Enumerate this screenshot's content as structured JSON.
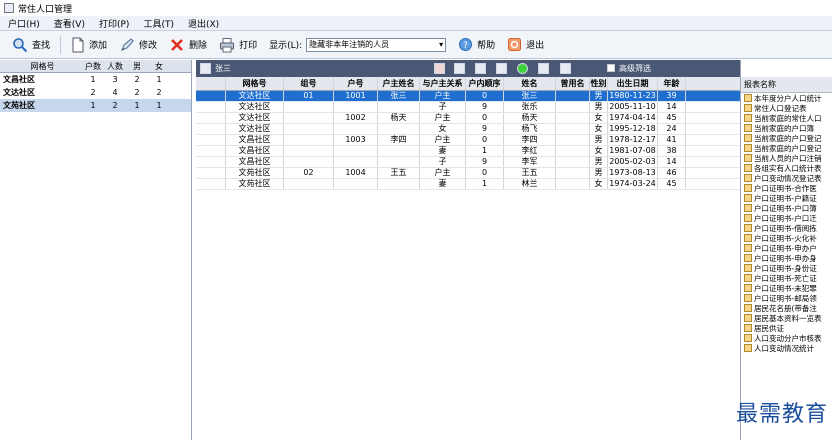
{
  "window": {
    "title": "常住人口管理"
  },
  "menu": [
    "户口(H)",
    "查看(V)",
    "打印(P)",
    "工具(T)",
    "退出(X)"
  ],
  "toolbar": {
    "search": "查找",
    "add": "添加",
    "edit": "修改",
    "delete": "删除",
    "print": "打印",
    "display_label": "显示(L):",
    "display_value": "隐藏非本年注销的人员",
    "help": "帮助",
    "exit": "退出"
  },
  "left_table": {
    "headers": [
      "网格号",
      "户数",
      "人数",
      "男",
      "女"
    ],
    "rows": [
      [
        "文昌社区",
        "1",
        "3",
        "2",
        "1"
      ],
      [
        "文达社区",
        "2",
        "4",
        "2",
        "2"
      ],
      [
        "文苑社区",
        "1",
        "2",
        "1",
        "1"
      ]
    ],
    "selected": 2
  },
  "main_toolbar": {
    "user": "张三",
    "filter_label": "高级筛选"
  },
  "main_table": {
    "headers": [
      "",
      "网格号",
      "组号",
      "户号",
      "户主姓名",
      "与户主关系",
      "户内顺序",
      "姓名",
      "曾用名",
      "性别",
      "出生日期",
      "年龄"
    ],
    "rows": [
      [
        "",
        "文达社区",
        "01",
        "1001",
        "张三",
        "户主",
        "0",
        "张三",
        "",
        "男",
        "1980-11-23",
        "39"
      ],
      [
        "",
        "文达社区",
        "",
        "",
        "",
        "子",
        "9",
        "张乐",
        "",
        "男",
        "2005-11-10",
        "14"
      ],
      [
        "",
        "文达社区",
        "",
        "1002",
        "杨天",
        "户主",
        "0",
        "杨天",
        "",
        "女",
        "1974-04-14",
        "45"
      ],
      [
        "",
        "文达社区",
        "",
        "",
        "",
        "女",
        "9",
        "杨飞",
        "",
        "女",
        "1995-12-18",
        "24"
      ],
      [
        "",
        "文昌社区",
        "",
        "1003",
        "李四",
        "户主",
        "0",
        "李四",
        "",
        "男",
        "1978-12-17",
        "41"
      ],
      [
        "",
        "文昌社区",
        "",
        "",
        "",
        "妻",
        "1",
        "李红",
        "",
        "女",
        "1981-07-08",
        "38"
      ],
      [
        "",
        "文昌社区",
        "",
        "",
        "",
        "子",
        "9",
        "李军",
        "",
        "男",
        "2005-02-03",
        "14"
      ],
      [
        "",
        "文苑社区",
        "02",
        "1004",
        "王五",
        "户主",
        "0",
        "王五",
        "",
        "男",
        "1973-08-13",
        "46"
      ],
      [
        "",
        "文苑社区",
        "",
        "",
        "",
        "妻",
        "1",
        "林兰",
        "",
        "女",
        "1974-03-24",
        "45"
      ]
    ],
    "selected": 0
  },
  "report_panel": {
    "header": "报表名称",
    "items": [
      "本年度分户人口统计",
      "常住人口登记表",
      "当前家庭的常住人口",
      "当前家庭的户口簿",
      "当前家庭的户口登记",
      "当前家庭的户口登记",
      "当前人员的户口注销",
      "各组实有人口统计表",
      "户口变动情况登记表",
      "户口证明书-合作医",
      "户口证明书-户籍证",
      "户口证明书-户口簿",
      "户口证明书-户口迁",
      "户口证明书-借阅拣",
      "户口证明书-火化补",
      "户口证明书-申办户",
      "户口证明书-申办身",
      "户口证明书-身份证",
      "户口证明书-死亡证",
      "户口证明书-未犯罪",
      "户口证明书-邮局领",
      "居民花名册(带备注",
      "居民基本资料一览表",
      "居民供证",
      "人口变动分户市核表",
      "人口变动情况统计"
    ]
  },
  "watermark": "最需教育"
}
